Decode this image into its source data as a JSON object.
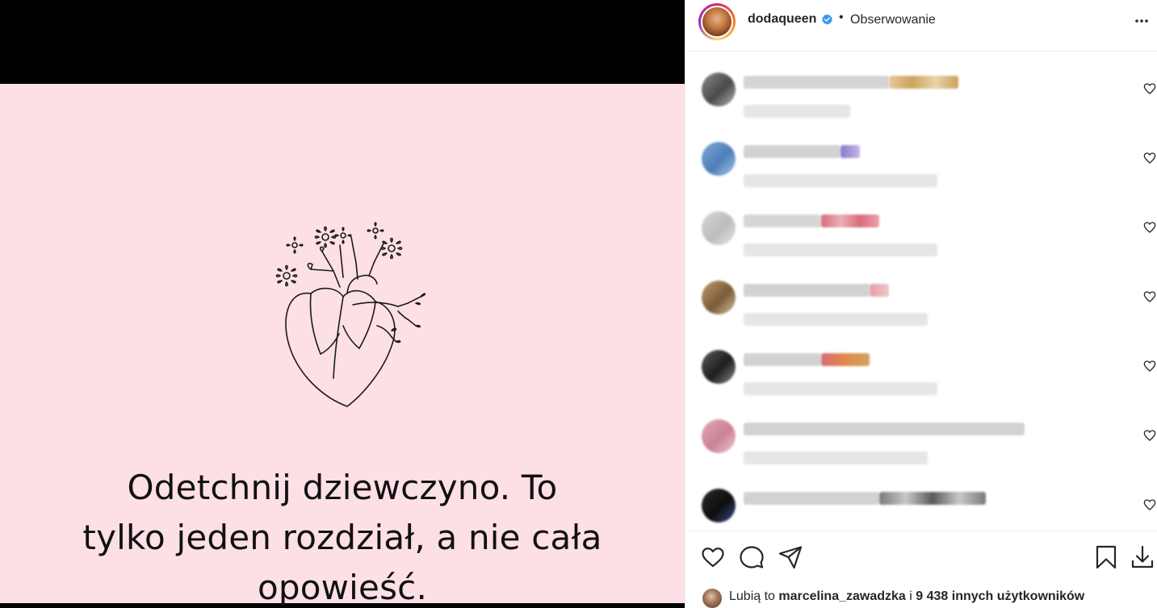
{
  "post": {
    "quote_line1": "Odetchnij dziewczyno. To",
    "quote_line2": "tylko jeden rozdział, a nie cała",
    "quote_line3": "opowieść."
  },
  "header": {
    "username": "dodaqueen",
    "separator": "•",
    "follow_status": "Obserwowanie",
    "more_icon": "more-horizontal-icon",
    "verified_color": "#3897f0"
  },
  "comments": {
    "count_visible": 7,
    "state": "blurred"
  },
  "actions": {
    "like_icon": "heart-outline-icon",
    "comment_icon": "comment-bubble-icon",
    "share_icon": "paper-plane-icon",
    "save_icon": "bookmark-icon",
    "download_icon": "download-icon"
  },
  "likes": {
    "prefix": "Lubią to",
    "user": "marcelina_zawadzka",
    "connector": "i",
    "count_text": "9 438 innych użytkowników"
  },
  "colors": {
    "media_background": "#fde0e6",
    "letterbox": "#000000",
    "text_primary": "#262626",
    "divider": "#efefef"
  }
}
